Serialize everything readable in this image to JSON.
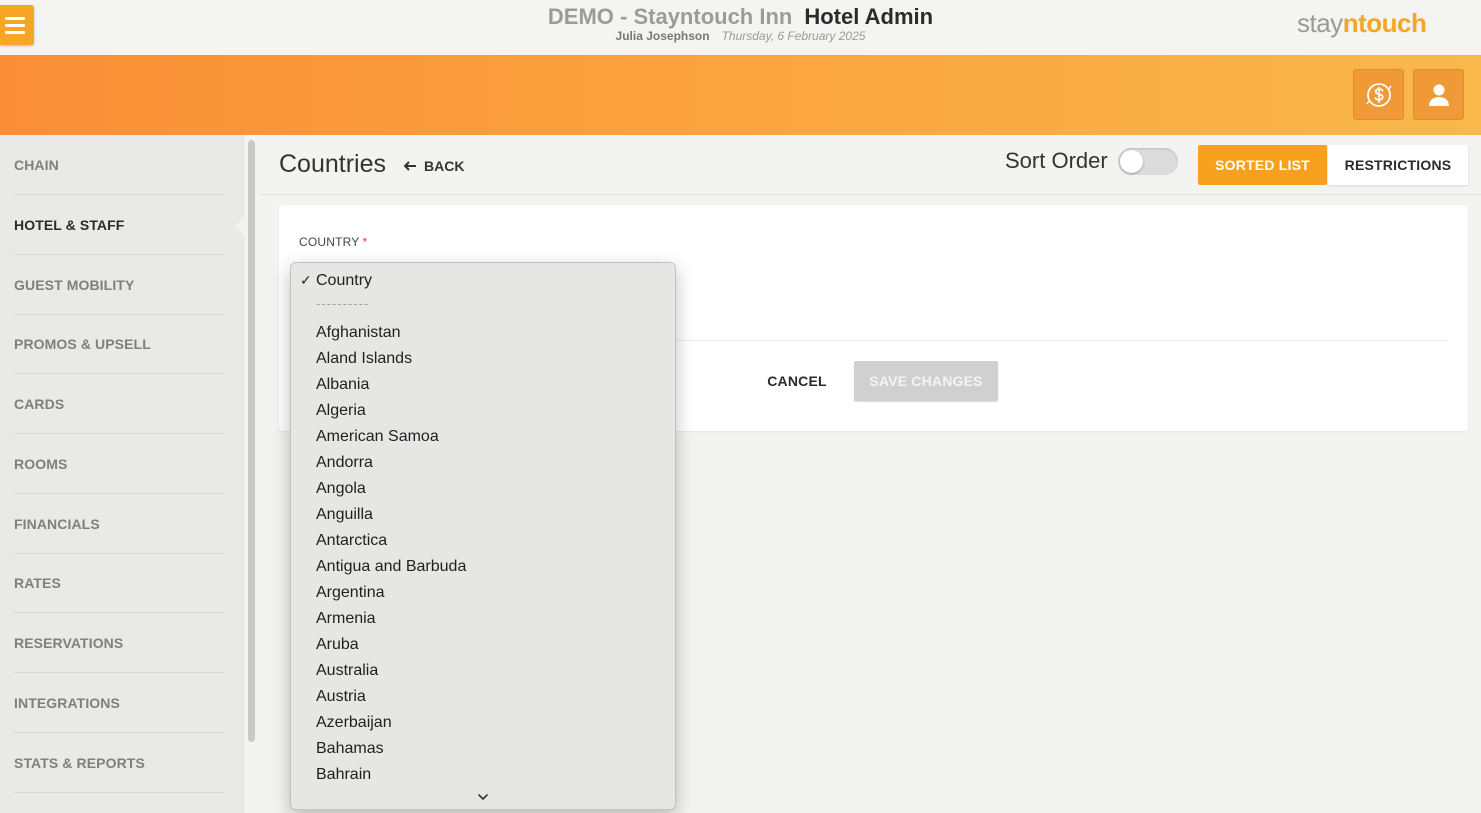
{
  "header": {
    "demo_title": "DEMO - Stayntouch Inn",
    "app_title": "Hotel Admin",
    "user_name": "Julia Josephson",
    "date": "Thursday, 6 February 2025",
    "brand_prefix": "stay",
    "brand_highlight": "ntouch",
    "accent_color": "#f6a623"
  },
  "sidebar": {
    "items": [
      {
        "label": "CHAIN",
        "active": false
      },
      {
        "label": "HOTEL & STAFF",
        "active": true
      },
      {
        "label": "GUEST MOBILITY",
        "active": false
      },
      {
        "label": "PROMOS & UPSELL",
        "active": false
      },
      {
        "label": "CARDS",
        "active": false
      },
      {
        "label": "ROOMS",
        "active": false
      },
      {
        "label": "FINANCIALS",
        "active": false
      },
      {
        "label": "RATES",
        "active": false
      },
      {
        "label": "RESERVATIONS",
        "active": false
      },
      {
        "label": "INTEGRATIONS",
        "active": false
      },
      {
        "label": "STATS & REPORTS",
        "active": false
      }
    ]
  },
  "page": {
    "title": "Countries",
    "back_label": "BACK",
    "sort_order_label": "Sort Order",
    "sort_order_on": false,
    "sorted_list_label": "SORTED LIST",
    "restrictions_label": "RESTRICTIONS"
  },
  "form": {
    "country_label": "COUNTRY",
    "required_mark": "*",
    "cancel_label": "CANCEL",
    "save_label": "SAVE CHANGES"
  },
  "dropdown": {
    "selected": "Country",
    "check_mark": "✓",
    "separator": "----------",
    "options": [
      "Afghanistan",
      "Aland Islands",
      "Albania",
      "Algeria",
      "American Samoa",
      "Andorra",
      "Angola",
      "Anguilla",
      "Antarctica",
      "Antigua and Barbuda",
      "Argentina",
      "Armenia",
      "Aruba",
      "Australia",
      "Austria",
      "Azerbaijan",
      "Bahamas",
      "Bahrain"
    ]
  }
}
